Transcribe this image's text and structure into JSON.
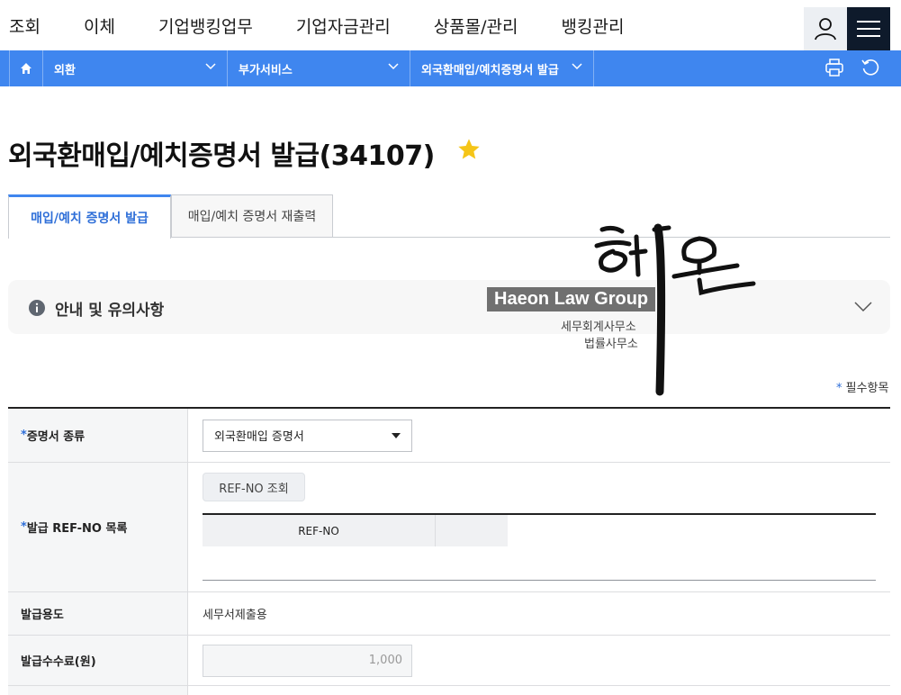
{
  "topnav": {
    "items": [
      "조회",
      "이체",
      "기업뱅킹업무",
      "기업자금관리",
      "상품몰/관리",
      "뱅킹관리"
    ]
  },
  "breadcrumb": {
    "level1": "외환",
    "level2": "부가서비스",
    "level3": "외국환매입/예치증명서 발급"
  },
  "page": {
    "title": "외국환매입/예치증명서 발급(34107)"
  },
  "tabs": {
    "issue": "매입/예치 증명서 발급",
    "reprint": "매입/예치 증명서 재출력"
  },
  "notice": {
    "label": "안내 및 유의사항"
  },
  "watermark": {
    "brand": "Haeon Law Group",
    "line1": "세무회계사무소",
    "line2": "법률사무소",
    "signature_text": "해온"
  },
  "form": {
    "required_mark": "*",
    "required_note": "필수항목",
    "cert_type_label": "증명서 종류",
    "cert_type_value": "외국환매입 증명서",
    "refno_list_label": "발급 REF-NO 목록",
    "refno_search_button": "REF-NO 조회",
    "refno_col": "REF-NO",
    "purpose_label": "발급용도",
    "purpose_value": "세무서제출용",
    "fee_label": "발급수수료(원)",
    "fee_value": "1,000"
  },
  "colors": {
    "accent": "#3f86ef",
    "menu_button": "#0e1a2b",
    "star": "#f5c518"
  }
}
